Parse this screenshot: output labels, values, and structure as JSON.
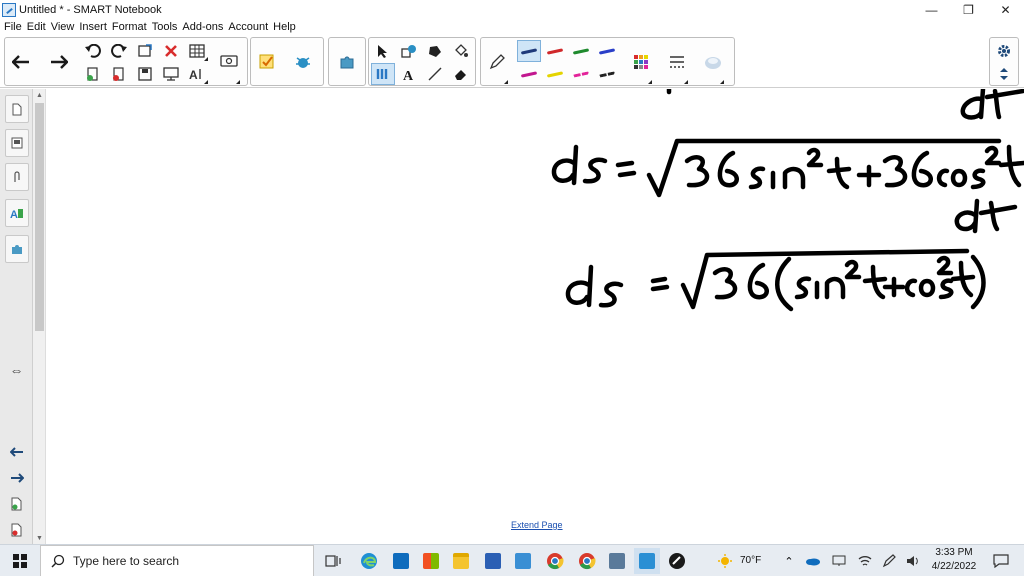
{
  "window": {
    "title": "Untitled * - SMART Notebook",
    "minimize": "—",
    "restore": "❐",
    "close": "✕"
  },
  "menu": [
    "File",
    "Edit",
    "View",
    "Insert",
    "Format",
    "Tools",
    "Add-ons",
    "Account",
    "Help"
  ],
  "toolbar": {
    "pen_colors": [
      "#1f3a7a",
      "#d0282a",
      "#1f8a2e",
      "#2a3fc8",
      "#c2178f",
      "#e4d400",
      "#e3239a",
      "#222222"
    ],
    "icons": {
      "back": "back-arrow-icon",
      "forward": "forward-arrow-icon",
      "undo": "undo-icon",
      "redo": "redo-icon",
      "delete": "delete-icon",
      "table": "table-icon"
    }
  },
  "canvas": {
    "extend_page": "Extend Page"
  },
  "taskbar": {
    "search_placeholder": "Type here to search",
    "weather": "70°F",
    "time": "3:33 PM",
    "date": "4/22/2022"
  }
}
